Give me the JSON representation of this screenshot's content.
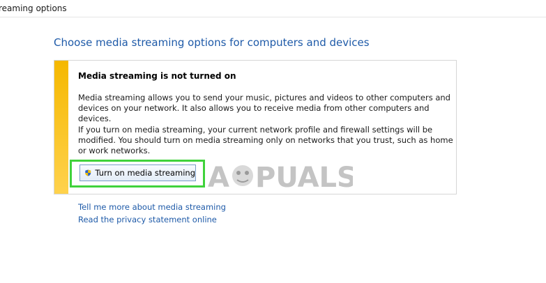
{
  "window": {
    "title_fragment": "reaming options"
  },
  "page": {
    "heading": "Choose media streaming options for computers and devices"
  },
  "panel": {
    "title": "Media streaming is not turned on",
    "paragraph1": "Media streaming allows you to send your music, pictures and videos to other computers and devices on your network.  It also allows you to receive media from other computers and devices.",
    "paragraph2": "If you turn on media streaming, your current network profile and firewall settings will be modified. You should turn on media streaming only on networks that you trust, such as home or work networks.",
    "accent_color": "#f5b800"
  },
  "button": {
    "label": "Turn on media streaming",
    "icon": "uac-shield-icon"
  },
  "links": [
    {
      "label": "Tell me more about media streaming"
    },
    {
      "label": "Read the privacy statement online"
    }
  ],
  "watermark": {
    "text": "APPUALS"
  },
  "colors": {
    "link_blue": "#1e5aa8",
    "highlight_green": "#40d23b"
  }
}
